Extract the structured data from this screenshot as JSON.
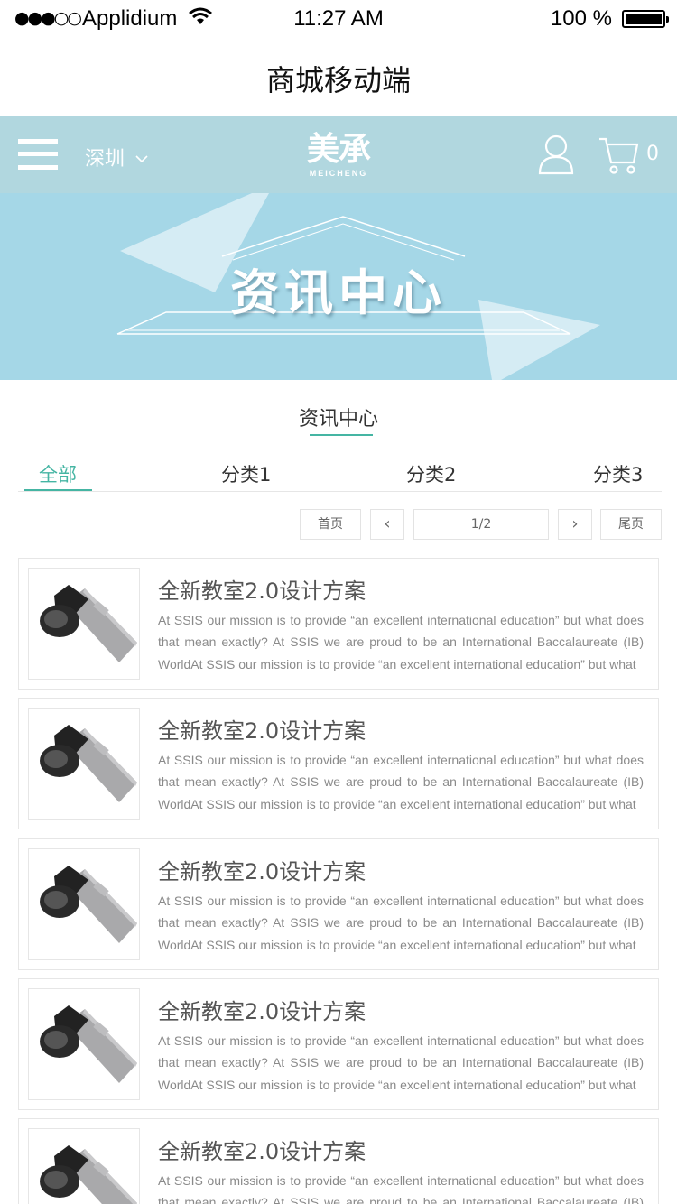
{
  "status_bar": {
    "signal": "●●●○○",
    "carrier": "Applidium",
    "time": "11:27 AM",
    "battery": "100 %"
  },
  "page_title": "商城移动端",
  "header": {
    "city": "深圳",
    "logo_cn": "美承",
    "logo_en": "MEICHENG",
    "cart_count": "0"
  },
  "banner": {
    "title": "资讯中心"
  },
  "section": {
    "title": "资讯中心"
  },
  "tabs": [
    {
      "label": "全部",
      "active": true
    },
    {
      "label": "分类1",
      "active": false
    },
    {
      "label": "分类2",
      "active": false
    },
    {
      "label": "分类3",
      "active": false
    }
  ],
  "pagination": {
    "first": "首页",
    "prev": "‹",
    "page": "1/2",
    "next": "›",
    "last": "尾页"
  },
  "articles": [
    {
      "title": "全新教室2.0设计方案",
      "desc": "At SSIS our mission is to provide “an excellent international education” but what does that mean exactly? At SSIS we are proud to be an International Baccalaureate (IB) WorldAt SSIS our mission is to provide “an excellent international education” but what"
    },
    {
      "title": "全新教室2.0设计方案",
      "desc": "At SSIS our mission is to provide “an excellent international education” but what does that mean exactly? At SSIS we are proud to be an International Baccalaureate (IB) WorldAt SSIS our mission is to provide “an excellent international education” but what"
    },
    {
      "title": "全新教室2.0设计方案",
      "desc": "At SSIS our mission is to provide “an excellent international education” but what does that mean exactly? At SSIS we are proud to be an International Baccalaureate (IB) WorldAt SSIS our mission is to provide “an excellent international education” but what"
    },
    {
      "title": "全新教室2.0设计方案",
      "desc": "At SSIS our mission is to provide “an excellent international education” but what does that mean exactly? At SSIS we are proud to be an International Baccalaureate (IB) WorldAt SSIS our mission is to provide “an excellent international education” but what"
    },
    {
      "title": "全新教室2.0设计方案",
      "desc": "At SSIS our mission is to provide “an excellent international education” but what does that mean exactly? At SSIS we are proud to be an International Baccalaureate (IB) WorldAt SSIS our mission is to provide “an excellent international education” but what"
    }
  ],
  "colors": {
    "header_bg": "#b1d7df",
    "banner_bg": "#a5d7e7",
    "accent": "#45b5a3"
  },
  "icons": {
    "menu": "hamburger-icon",
    "city_dropdown": "chevron-down-icon",
    "user": "user-icon",
    "cart": "cart-icon",
    "article_thumb": "bluetooth-headset-image"
  }
}
